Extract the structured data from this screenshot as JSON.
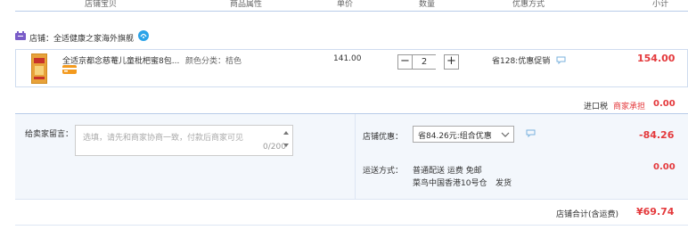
{
  "header": {
    "col_shop_product": "店铺宝贝",
    "col_attrs": "商品属性",
    "col_unit_price": "单价",
    "col_quantity": "数量",
    "col_promotion": "优惠方式",
    "col_subtotal": "小计"
  },
  "shop": {
    "label": "店铺：全适健康之家海外旗舰"
  },
  "item": {
    "title": "全适京都念慈菴儿童枇杷蜜8包...",
    "attr_label": "颜色分类：桔色",
    "unit_price": "141.00",
    "quantity": "2",
    "minus_label": "−",
    "plus_label": "+",
    "promotion": "省128:优惠促销",
    "subtotal": "154.00"
  },
  "tax": {
    "label": "进口税",
    "bearer": "商家承担",
    "amount": "0.00"
  },
  "message": {
    "label": "给卖家留言：",
    "placeholder": "选填，请先和商家协商一致，付款后商家可见",
    "counter": "0/200"
  },
  "discount": {
    "label": "店铺优惠：",
    "selected": "省84.26元:组合优惠",
    "amount": "-84.26"
  },
  "shipping": {
    "label": "运送方式：",
    "method": "普通配送 运费 免邮",
    "warehouse": "菜鸟中国香港10号仓",
    "dispatch": "发货",
    "amount": "0.00"
  },
  "total": {
    "label": "店铺合计(含运费)",
    "amount": "¥69.74"
  },
  "colors": {
    "accent_red": "#e4393c",
    "border_blue": "#b8cce8",
    "panel_bg": "#f3f7fc",
    "shop_icon": "#7a5cc8",
    "tmall_badge": "#2aa3e8"
  }
}
